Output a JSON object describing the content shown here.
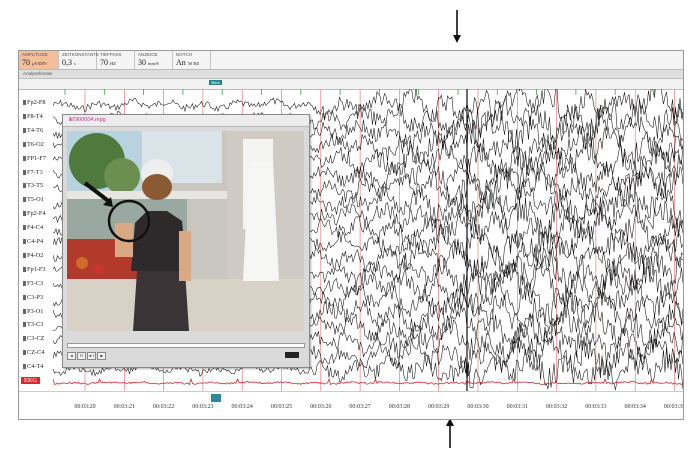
{
  "params": [
    {
      "label": "AMPLITUDE",
      "value": "70",
      "unit": "µV/DIV",
      "active": true
    },
    {
      "label": "ZEITKONSTANTE",
      "value": "0,3",
      "unit": "s",
      "active": false
    },
    {
      "label": "TIEFPASS",
      "value": "70",
      "unit": "HZ",
      "active": false
    },
    {
      "label": "ANZEIGE",
      "value": "30",
      "unit": "mm/S",
      "active": false
    },
    {
      "label": "NOTCH",
      "value": "An",
      "unit": "50 HZ",
      "active": false
    }
  ],
  "analysis_label": "Analysefenster",
  "channels": [
    "Fp2-F8",
    "F8-T4",
    "T4-T6",
    "T6-O2",
    "FP1-F7",
    "F7-T3",
    "T3-T5",
    "T5-O1",
    "Fp2-F4",
    "F4-C4",
    "C4-P4",
    "P4-O2",
    "Fp1-F3",
    "F3-C3",
    "C3-P3",
    "P3-O1",
    "T3-C3",
    "C3-CZ",
    "CZ-C4",
    "C4-T4",
    "EKG"
  ],
  "time_labels": [
    "00:03:20",
    "00:03:21",
    "00:03:22",
    "00:03:23",
    "00:03:24",
    "00:03:25",
    "00:03:26",
    "00:03:27",
    "00:03:28",
    "00:03:29",
    "00:03:30",
    "00:03:31",
    "00:03:32",
    "00:03:33",
    "00:03:34",
    "00:03:35"
  ],
  "video": {
    "title": "17900004.mpg",
    "controls": [
      "◄",
      "II",
      "►I",
      "■"
    ]
  },
  "markers": {
    "top_tag": "Mark",
    "bottom_tag": "",
    "seizure_tag": ""
  },
  "colors": {
    "amplitude_active": "#f3bf9b",
    "ecg": "#d82a2a",
    "grid_red": "#e36b6b",
    "grid_green": "#3aa64a"
  }
}
